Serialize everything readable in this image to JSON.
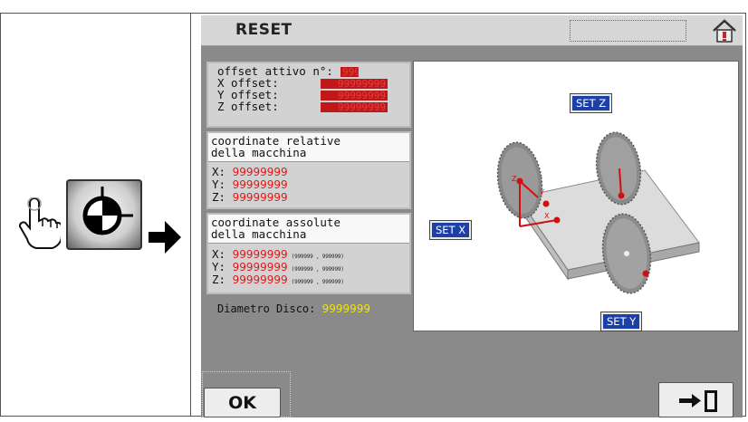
{
  "screen": {
    "title": "RESET",
    "ok_label": "OK"
  },
  "offset_panel": {
    "active_label": "offset attivo n°:",
    "active_value": "999",
    "rows": [
      {
        "label": "X offset:",
        "value": "99999999"
      },
      {
        "label": "Y offset:",
        "value": "99999999"
      },
      {
        "label": "Z offset:",
        "value": "99999999"
      }
    ]
  },
  "relative_panel": {
    "title_line1": "coordinate relative",
    "title_line2": "della macchina",
    "rows": [
      {
        "axis": "X:",
        "value": "99999999"
      },
      {
        "axis": "Y:",
        "value": "99999999"
      },
      {
        "axis": "Z:",
        "value": "99999999"
      }
    ]
  },
  "absolute_panel": {
    "title_line1": "coordinate assolute",
    "title_line2": "della macchina",
    "rows": [
      {
        "axis": "X:",
        "value": "99999999",
        "range": "(999999 , 999999)"
      },
      {
        "axis": "Y:",
        "value": "99999999",
        "range": "(999999 , 999999)"
      },
      {
        "axis": "Z:",
        "value": "99999999",
        "range": "(999999 , 999999)"
      }
    ]
  },
  "disc": {
    "label": "Diametro Disco:",
    "value": "9999999"
  },
  "diagram": {
    "set_z": "SET Z",
    "set_x": "SET X",
    "set_y": "SET Y",
    "axis_z": "Z",
    "axis_y": "Y",
    "axis_x": "X"
  },
  "icons": {
    "hand": "pointing-hand-icon",
    "target": "crosshair-target-icon",
    "arrow": "right-arrow-icon",
    "home": "home-warning-icon",
    "exit": "exit-door-icon"
  },
  "colors": {
    "screen_bg": "#8a8a8a",
    "value_red": "#e01818",
    "value_yellow": "#f2e600",
    "set_button_blue": "#1c3fa8"
  }
}
